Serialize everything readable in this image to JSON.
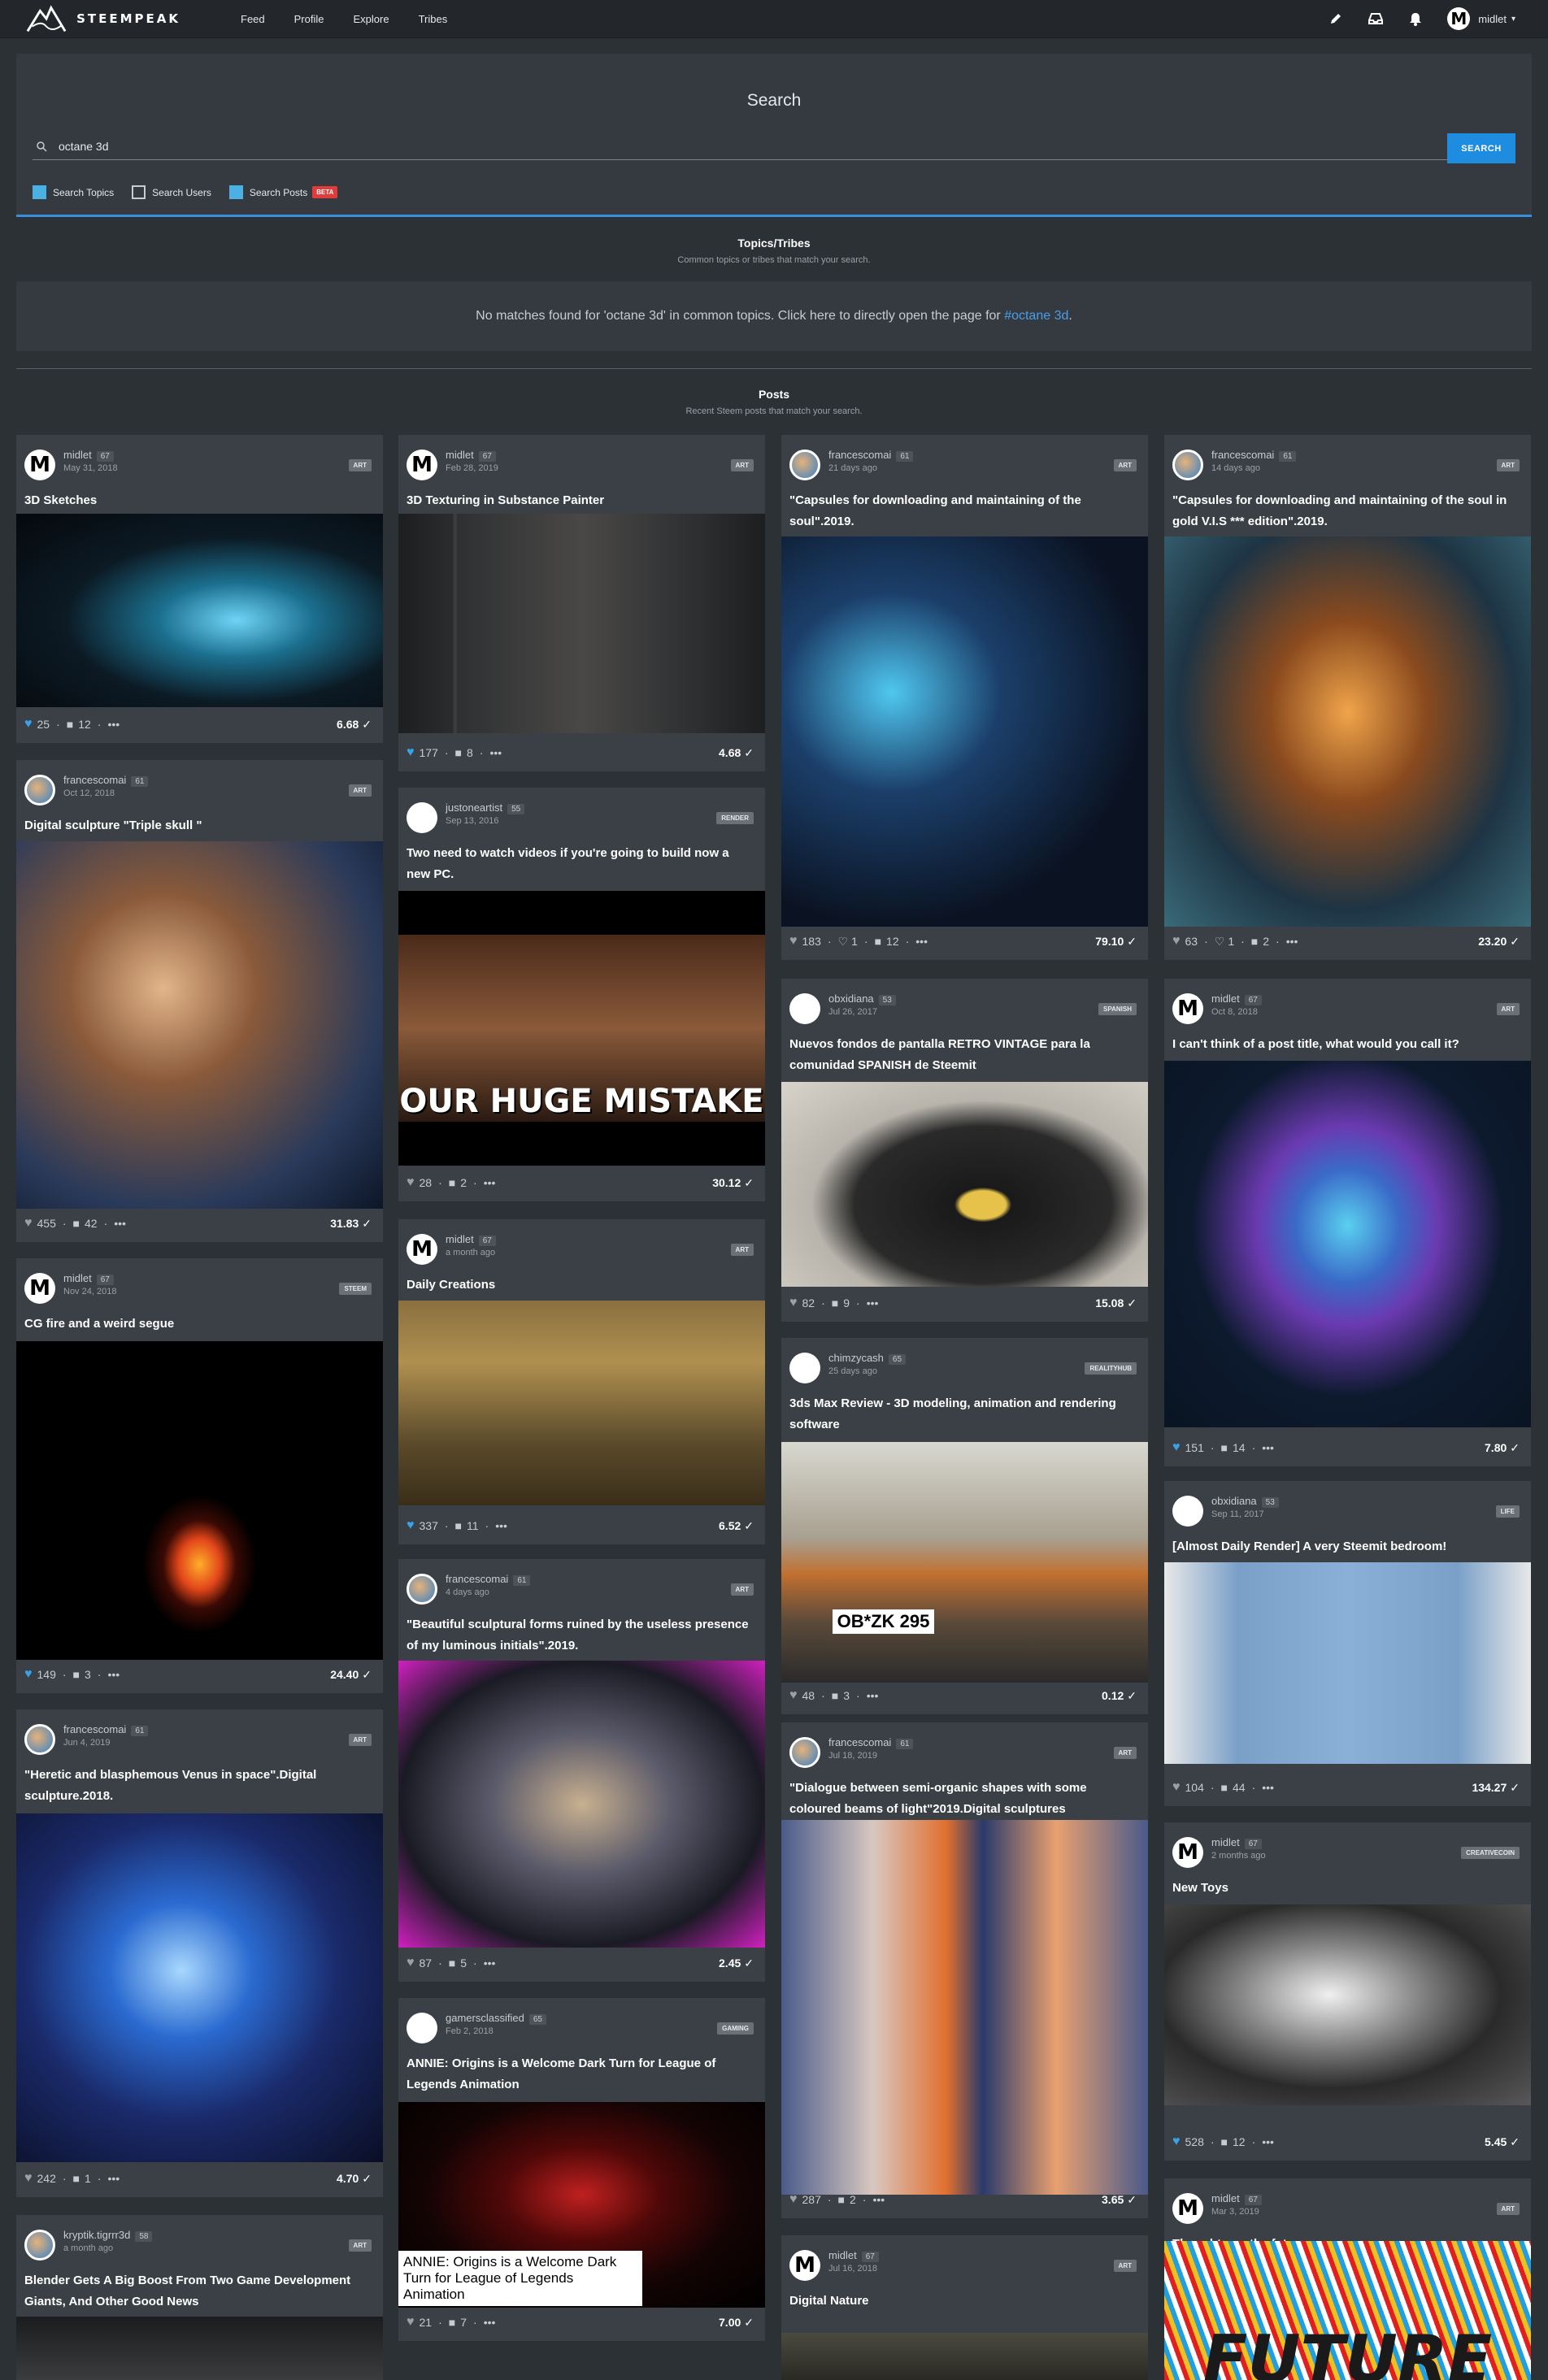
{
  "brand": {
    "name": "STEEMPEAK"
  },
  "nav": [
    "Feed",
    "Profile",
    "Explore",
    "Tribes"
  ],
  "user": {
    "name": "midlet",
    "initial": "M"
  },
  "search": {
    "title": "Search",
    "query": "octane 3d",
    "button": "SEARCH",
    "options": [
      {
        "label": "Search Topics",
        "checked": true
      },
      {
        "label": "Search Users",
        "checked": false
      },
      {
        "label": "Search Posts",
        "checked": true,
        "badge": "BETA"
      }
    ]
  },
  "topics": {
    "title": "Topics/Tribes",
    "subtitle": "Common topics or tribes that match your search.",
    "nomatch_pre": "No matches found for 'octane 3d' in common topics. Click here to directly open the page for ",
    "nomatch_tag": "#octane 3d",
    "nomatch_post": "."
  },
  "posts_section": {
    "title": "Posts",
    "subtitle": "Recent Steem posts that match your search."
  },
  "posts": [
    {
      "author": "midlet",
      "rep": "67",
      "date": "May 31, 2018",
      "tag": "ART",
      "title": "3D Sketches",
      "likes": "25",
      "comments": "12",
      "payout": "6.68",
      "liked": true
    },
    {
      "author": "midlet",
      "rep": "67",
      "date": "Feb 28, 2019",
      "tag": "ART",
      "title": "3D Texturing in Substance Painter",
      "likes": "177",
      "comments": "8",
      "payout": "4.68",
      "liked": true
    },
    {
      "author": "francescomai",
      "rep": "61",
      "date": "21 days ago",
      "tag": "ART",
      "title": "\"Capsules for downloading and maintaining of the soul\".2019.",
      "likes": "183",
      "flags": "1",
      "comments": "12",
      "payout": "79.10",
      "liked": false
    },
    {
      "author": "francescomai",
      "rep": "61",
      "date": "14 days ago",
      "tag": "ART",
      "title": "\"Capsules for downloading and maintaining of the soul in gold V.I.S *** edition\".2019.",
      "likes": "63",
      "flags": "1",
      "comments": "2",
      "payout": "23.20",
      "liked": false
    },
    {
      "author": "francescomai",
      "rep": "61",
      "date": "Oct 12, 2018",
      "tag": "ART",
      "title": "Digital sculpture \"Triple skull \"",
      "likes": "455",
      "comments": "42",
      "payout": "31.83",
      "liked": false
    },
    {
      "author": "justoneartist",
      "rep": "55",
      "date": "Sep 13, 2016",
      "tag": "RENDER",
      "title": "Two need to watch videos if you're going to build now a new PC.",
      "likes": "28",
      "comments": "2",
      "payout": "30.12",
      "liked": false,
      "thumb_text": "OUR HUGE MISTAKE"
    },
    {
      "author": "obxidiana",
      "rep": "53",
      "date": "Jul 26, 2017",
      "tag": "SPANISH",
      "title": "Nuevos fondos de pantalla RETRO VINTAGE para la comunidad SPANISH de Steemit",
      "likes": "82",
      "comments": "9",
      "payout": "15.08",
      "liked": false
    },
    {
      "author": "midlet",
      "rep": "67",
      "date": "Oct 8, 2018",
      "tag": "ART",
      "title": "I can't think of a post title, what would you call it?",
      "likes": "151",
      "comments": "14",
      "payout": "7.80",
      "liked": true
    },
    {
      "author": "midlet",
      "rep": "67",
      "date": "Nov 24, 2018",
      "tag": "STEEM",
      "title": "CG fire and a weird segue",
      "likes": "149",
      "comments": "3",
      "payout": "24.40",
      "liked": true
    },
    {
      "author": "midlet",
      "rep": "67",
      "date": "a month ago",
      "tag": "ART",
      "title": "Daily Creations",
      "likes": "337",
      "comments": "11",
      "payout": "6.52",
      "liked": true
    },
    {
      "author": "chimzycash",
      "rep": "65",
      "date": "25 days ago",
      "tag": "REALITYHUB",
      "title": "3ds Max Review - 3D modeling, animation and rendering software",
      "likes": "48",
      "comments": "3",
      "payout": "0.12",
      "liked": false,
      "thumb_text": "OB*ZK 295"
    },
    {
      "author": "obxidiana",
      "rep": "53",
      "date": "Sep 11, 2017",
      "tag": "LIFE",
      "title": "[Almost Daily Render] A very Steemit bedroom!",
      "likes": "104",
      "comments": "44",
      "payout": "134.27",
      "liked": false
    },
    {
      "author": "francescomai",
      "rep": "61",
      "date": "Jun 4, 2019",
      "tag": "ART",
      "title": "\"Heretic and blasphemous Venus in space\".Digital sculpture.2018.",
      "likes": "242",
      "comments": "1",
      "payout": "4.70",
      "liked": false
    },
    {
      "author": "francescomai",
      "rep": "61",
      "date": "4 days ago",
      "tag": "ART",
      "title": "\"Beautiful sculptural forms ruined by the useless presence of my luminous initials\".2019.",
      "likes": "87",
      "comments": "5",
      "payout": "2.45",
      "liked": false
    },
    {
      "author": "francescomai",
      "rep": "61",
      "date": "Jul 18, 2019",
      "tag": "ART",
      "title": "\"Dialogue between semi-organic shapes with some coloured beams of light\"2019.Digital sculptures",
      "likes": "287",
      "comments": "2",
      "payout": "3.65",
      "liked": false
    },
    {
      "author": "midlet",
      "rep": "67",
      "date": "2 months ago",
      "tag": "CREATIVECOIN",
      "title": "New Toys",
      "likes": "528",
      "comments": "12",
      "payout": "5.45",
      "liked": true
    },
    {
      "author": "gamersclassified",
      "rep": "65",
      "date": "Feb 2, 2018",
      "tag": "GAMING",
      "title": "ANNIE: Origins is a Welcome Dark Turn for League of Legends Animation",
      "likes": "21",
      "comments": "7",
      "payout": "7.00",
      "liked": false,
      "thumb_text": "ANNIE: Origins is a Welcome Dark Turn for League of Legends Animation"
    },
    {
      "author": "kryptik.tigrrr3d",
      "rep": "58",
      "date": "a month ago",
      "tag": "ART",
      "title": "Blender Gets A Big Boost From Two Game Development Giants, And Other Good News"
    },
    {
      "author": "midlet",
      "rep": "67",
      "date": "Mar 3, 2019",
      "tag": "ART",
      "title": "Thoughts on the future.",
      "thumb_text": "FUTURE"
    },
    {
      "author": "midlet",
      "rep": "67",
      "date": "Jul 16, 2018",
      "tag": "ART",
      "title": "Digital Nature"
    }
  ]
}
